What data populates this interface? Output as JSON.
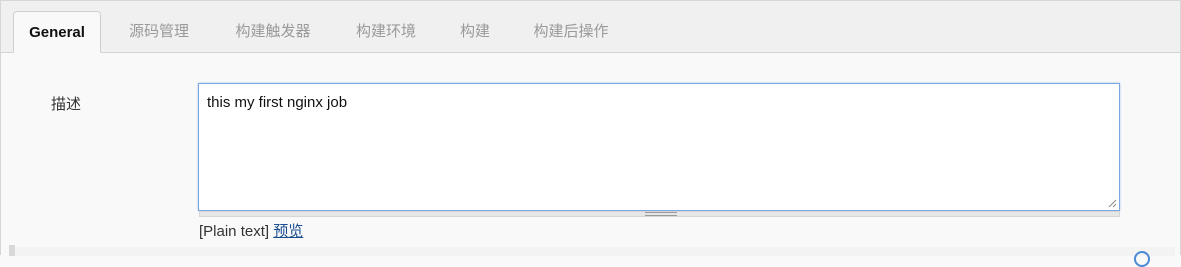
{
  "tabs": [
    {
      "label": "General",
      "active": true
    },
    {
      "label": "源码管理",
      "active": false
    },
    {
      "label": "构建触发器",
      "active": false
    },
    {
      "label": "构建环境",
      "active": false
    },
    {
      "label": "构建",
      "active": false
    },
    {
      "label": "构建后操作",
      "active": false
    }
  ],
  "description": {
    "label": "描述",
    "value": "this my first nginx job",
    "format_prefix": "[Plain text]",
    "preview_link": "预览"
  },
  "colors": {
    "tab_bar_bg": "#f0f0f0",
    "focus_border": "#7aa7e2",
    "link": "#1a4d8f"
  }
}
